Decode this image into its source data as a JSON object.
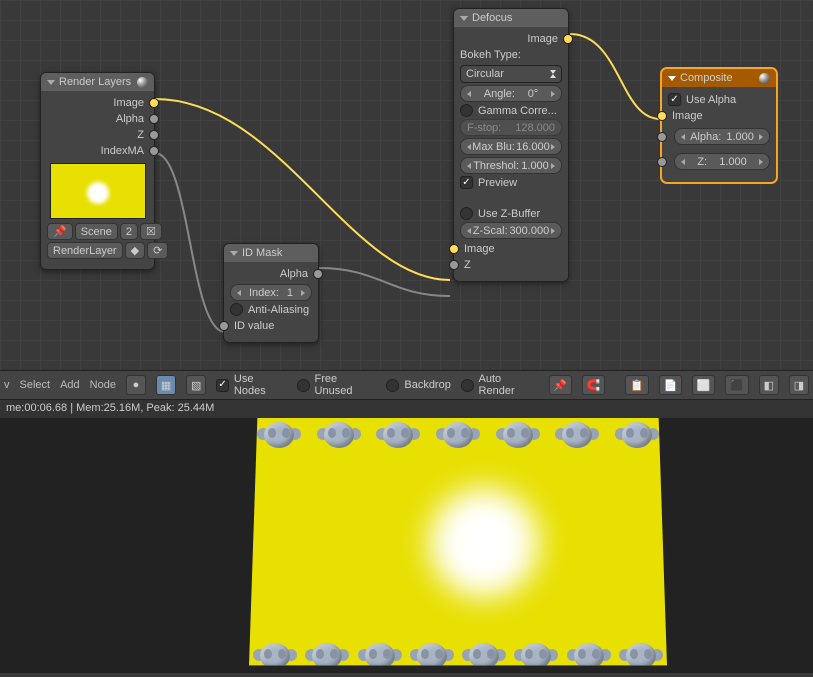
{
  "nodes": {
    "renderLayers": {
      "title": "Render Layers",
      "outputs": {
        "image": "Image",
        "alpha": "Alpha",
        "z": "Z",
        "indexma": "IndexMA"
      },
      "scene": "Scene",
      "scene_user": "2",
      "layer": "RenderLayer"
    },
    "idMask": {
      "title": "ID Mask",
      "outputs": {
        "alpha": "Alpha"
      },
      "index_label": "Index:",
      "index_value": "1",
      "aa": "Anti-Aliasing",
      "inputs": {
        "idvalue": "ID value"
      }
    },
    "defocus": {
      "title": "Defocus",
      "outputs": {
        "image": "Image"
      },
      "bokeh_label": "Bokeh Type:",
      "bokeh_value": "Circular",
      "angle_label": "Angle:",
      "angle_value": "0°",
      "gamma": "Gamma Corre...",
      "fstop_label": "F-stop:",
      "fstop_value": "128.000",
      "maxblur_label": "Max Blu:",
      "maxblur_value": "16.000",
      "thresh_label": "Threshol:",
      "thresh_value": "1.000",
      "preview": "Preview",
      "zbuffer": "Use Z-Buffer",
      "zscale_label": "Z-Scal:",
      "zscale_value": "300.000",
      "inputs": {
        "image": "Image",
        "z": "Z"
      }
    },
    "composite": {
      "title": "Composite",
      "use_alpha": "Use Alpha",
      "inputs": {
        "image": "Image",
        "alpha_label": "Alpha:",
        "alpha_value": "1.000",
        "z_label": "Z:",
        "z_value": "1.000"
      }
    }
  },
  "toolbar": {
    "view": "v",
    "select": "Select",
    "add": "Add",
    "node": "Node",
    "use_nodes": "Use Nodes",
    "free_unused": "Free Unused",
    "backdrop": "Backdrop",
    "auto_render": "Auto Render"
  },
  "status": "me:00:06.68 | Mem:25.16M, Peak: 25.44M"
}
